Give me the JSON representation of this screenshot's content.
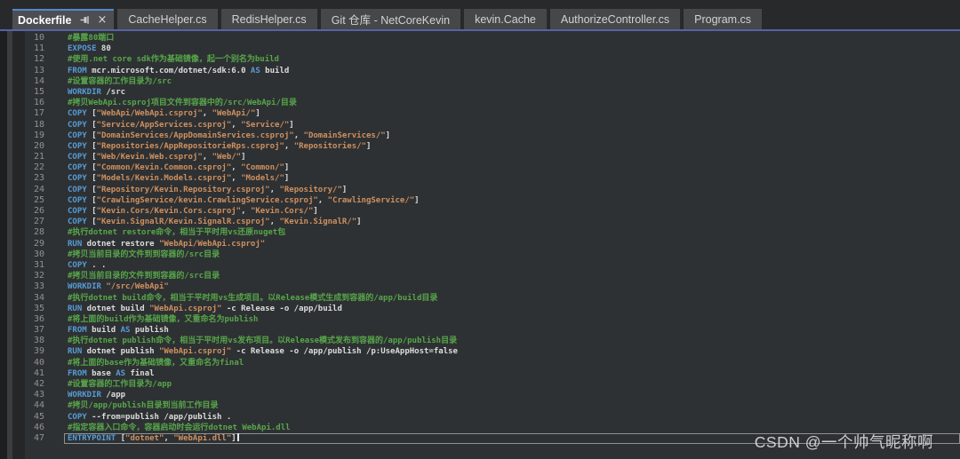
{
  "tab_bar": {
    "tabs": [
      {
        "label": "Dockerfile",
        "active": true,
        "pin": true,
        "close": "×"
      },
      {
        "label": "CacheHelper.cs",
        "active": false
      },
      {
        "label": "RedisHelper.cs",
        "active": false
      },
      {
        "label": "Git 仓库 - NetCoreKevin",
        "active": false
      },
      {
        "label": "kevin.Cache",
        "active": false
      },
      {
        "label": "AuthorizeController.cs",
        "active": false
      },
      {
        "label": "Program.cs",
        "active": false
      }
    ]
  },
  "editor": {
    "language": "dockerfile",
    "first_line_number": 10,
    "current_line": 47,
    "caret_line": 47,
    "lines": [
      {
        "n": 10,
        "segs": [
          [
            "c",
            "#暴露80端口"
          ]
        ]
      },
      {
        "n": 11,
        "segs": [
          [
            "k",
            "EXPOSE"
          ],
          [
            "p",
            " 80"
          ]
        ]
      },
      {
        "n": 12,
        "segs": [
          [
            "c",
            "#使用.net core sdk作为基础镜像，起一个别名为build"
          ]
        ]
      },
      {
        "n": 13,
        "segs": [
          [
            "k",
            "FROM"
          ],
          [
            "p",
            " mcr.microsoft.com/dotnet/sdk:6.0 "
          ],
          [
            "k",
            "AS"
          ],
          [
            "p",
            " build"
          ]
        ]
      },
      {
        "n": 14,
        "segs": [
          [
            "c",
            "#设置容器的工作目录为/src"
          ]
        ]
      },
      {
        "n": 15,
        "segs": [
          [
            "k",
            "WORKDIR"
          ],
          [
            "p",
            " /src"
          ]
        ]
      },
      {
        "n": 16,
        "segs": [
          [
            "c",
            "#拷贝WebApi.csproj项目文件到容器中的/src/WebApi/目录"
          ]
        ]
      },
      {
        "n": 17,
        "segs": [
          [
            "k",
            "COPY"
          ],
          [
            "p",
            " ["
          ],
          [
            "s",
            "\"WebApi/WebApi.csproj\""
          ],
          [
            "p",
            ", "
          ],
          [
            "s",
            "\"WebApi/\""
          ],
          [
            "p",
            "]"
          ]
        ]
      },
      {
        "n": 18,
        "segs": [
          [
            "k",
            "COPY"
          ],
          [
            "p",
            " ["
          ],
          [
            "s",
            "\"Service/AppServices.csproj\""
          ],
          [
            "p",
            ", "
          ],
          [
            "s",
            "\"Service/\""
          ],
          [
            "p",
            "]"
          ]
        ]
      },
      {
        "n": 19,
        "segs": [
          [
            "k",
            "COPY"
          ],
          [
            "p",
            " ["
          ],
          [
            "s",
            "\"DomainServices/AppDomainServices.csproj\""
          ],
          [
            "p",
            ", "
          ],
          [
            "s",
            "\"DomainServices/\""
          ],
          [
            "p",
            "]"
          ]
        ]
      },
      {
        "n": 20,
        "segs": [
          [
            "k",
            "COPY"
          ],
          [
            "p",
            " ["
          ],
          [
            "s",
            "\"Repositories/AppRepositorieRps.csproj\""
          ],
          [
            "p",
            ", "
          ],
          [
            "s",
            "\"Repositories/\""
          ],
          [
            "p",
            "]"
          ]
        ]
      },
      {
        "n": 21,
        "segs": [
          [
            "k",
            "COPY"
          ],
          [
            "p",
            " ["
          ],
          [
            "s",
            "\"Web/Kevin.Web.csproj\""
          ],
          [
            "p",
            ", "
          ],
          [
            "s",
            "\"Web/\""
          ],
          [
            "p",
            "]"
          ]
        ]
      },
      {
        "n": 22,
        "segs": [
          [
            "k",
            "COPY"
          ],
          [
            "p",
            " ["
          ],
          [
            "s",
            "\"Common/Kevin.Common.csproj\""
          ],
          [
            "p",
            ", "
          ],
          [
            "s",
            "\"Common/\""
          ],
          [
            "p",
            "]"
          ]
        ]
      },
      {
        "n": 23,
        "segs": [
          [
            "k",
            "COPY"
          ],
          [
            "p",
            " ["
          ],
          [
            "s",
            "\"Models/Kevin.Models.csproj\""
          ],
          [
            "p",
            ", "
          ],
          [
            "s",
            "\"Models/\""
          ],
          [
            "p",
            "]"
          ]
        ]
      },
      {
        "n": 24,
        "segs": [
          [
            "k",
            "COPY"
          ],
          [
            "p",
            " ["
          ],
          [
            "s",
            "\"Repository/Kevin.Repository.csproj\""
          ],
          [
            "p",
            ", "
          ],
          [
            "s",
            "\"Repository/\""
          ],
          [
            "p",
            "]"
          ]
        ]
      },
      {
        "n": 25,
        "segs": [
          [
            "k",
            "COPY"
          ],
          [
            "p",
            " ["
          ],
          [
            "s",
            "\"CrawlingService/kevin.CrawlingService.csproj\""
          ],
          [
            "p",
            ", "
          ],
          [
            "s",
            "\"CrawlingService/\""
          ],
          [
            "p",
            "]"
          ]
        ]
      },
      {
        "n": 26,
        "segs": [
          [
            "k",
            "COPY"
          ],
          [
            "p",
            " ["
          ],
          [
            "s",
            "\"Kevin.Cors/Kevin.Cors.csproj\""
          ],
          [
            "p",
            ", "
          ],
          [
            "s",
            "\"Kevin.Cors/\""
          ],
          [
            "p",
            "]"
          ]
        ]
      },
      {
        "n": 27,
        "segs": [
          [
            "k",
            "COPY"
          ],
          [
            "p",
            " ["
          ],
          [
            "s",
            "\"Kevin.SignalR/Kevin.SignalR.csproj\""
          ],
          [
            "p",
            ", "
          ],
          [
            "s",
            "\"Kevin.SignalR/\""
          ],
          [
            "p",
            "]"
          ]
        ]
      },
      {
        "n": 28,
        "segs": [
          [
            "c",
            "#执行dotnet restore命令，相当于平时用vs还原nuget包"
          ]
        ]
      },
      {
        "n": 29,
        "segs": [
          [
            "k",
            "RUN"
          ],
          [
            "p",
            " dotnet restore "
          ],
          [
            "s",
            "\"WebApi/WebApi.csproj\""
          ]
        ]
      },
      {
        "n": 30,
        "segs": [
          [
            "c",
            "#拷贝当前目录的文件到到容器的/src目录"
          ]
        ]
      },
      {
        "n": 31,
        "segs": [
          [
            "k",
            "COPY"
          ],
          [
            "p",
            " . ."
          ]
        ]
      },
      {
        "n": 32,
        "segs": [
          [
            "c",
            "#拷贝当前目录的文件到到容器的/src目录"
          ]
        ]
      },
      {
        "n": 33,
        "segs": [
          [
            "k",
            "WORKDIR"
          ],
          [
            "p",
            " "
          ],
          [
            "s",
            "\"/src/WebApi\""
          ]
        ]
      },
      {
        "n": 34,
        "segs": [
          [
            "c",
            "#执行dotnet build命令，相当于平时用vs生成项目。以Release模式生成到容器的/app/build目录"
          ]
        ]
      },
      {
        "n": 35,
        "segs": [
          [
            "k",
            "RUN"
          ],
          [
            "p",
            " dotnet build "
          ],
          [
            "s",
            "\"WebApi.csproj\""
          ],
          [
            "p",
            " -c Release -o /app/build"
          ]
        ]
      },
      {
        "n": 36,
        "segs": [
          [
            "c",
            "#将上面的build作为基础镜像，又重命名为publish"
          ]
        ]
      },
      {
        "n": 37,
        "segs": [
          [
            "k",
            "FROM"
          ],
          [
            "p",
            " build "
          ],
          [
            "k",
            "AS"
          ],
          [
            "p",
            " publish"
          ]
        ]
      },
      {
        "n": 38,
        "segs": [
          [
            "c",
            "#执行dotnet publish命令，相当于平时用vs发布项目。以Release模式发布到容器的/app/publish目录"
          ]
        ]
      },
      {
        "n": 39,
        "segs": [
          [
            "k",
            "RUN"
          ],
          [
            "p",
            " dotnet publish "
          ],
          [
            "s",
            "\"WebApi.csproj\""
          ],
          [
            "p",
            " -c Release -o /app/publish /p:UseAppHost=false"
          ]
        ]
      },
      {
        "n": 40,
        "segs": [
          [
            "c",
            "#将上面的base作为基础镜像，又重命名为final"
          ]
        ]
      },
      {
        "n": 41,
        "segs": [
          [
            "k",
            "FROM"
          ],
          [
            "p",
            " base "
          ],
          [
            "k",
            "AS"
          ],
          [
            "p",
            " final"
          ]
        ]
      },
      {
        "n": 42,
        "segs": [
          [
            "c",
            "#设置容器的工作目录为/app"
          ]
        ]
      },
      {
        "n": 43,
        "segs": [
          [
            "k",
            "WORKDIR"
          ],
          [
            "p",
            " /app"
          ]
        ]
      },
      {
        "n": 44,
        "segs": [
          [
            "c",
            "#拷贝/app/publish目录到当前工作目录"
          ]
        ]
      },
      {
        "n": 45,
        "segs": [
          [
            "k",
            "COPY"
          ],
          [
            "p",
            " --from=publish /app/publish ."
          ]
        ]
      },
      {
        "n": 46,
        "segs": [
          [
            "c",
            "#指定容器入口命令，容器启动时会运行dotnet WebApi.dll"
          ]
        ]
      },
      {
        "n": 47,
        "segs": [
          [
            "k",
            "ENTRYPOINT"
          ],
          [
            "p",
            " ["
          ],
          [
            "s",
            "\"dotnet\""
          ],
          [
            "p",
            ", "
          ],
          [
            "s",
            "\"WebApi.dll\""
          ],
          [
            "p",
            "]"
          ]
        ]
      }
    ]
  },
  "watermark": {
    "text": "CSDN @一个帅气昵称啊"
  },
  "colors": {
    "keyword": "#569cd6",
    "string": "#ce9060",
    "comment": "#57a64a",
    "plain": "#dcdcdc",
    "editor_bg": "#2e3133",
    "line_number": "#909294",
    "tab_active_border": "#4e8ad0",
    "tabstrip_underline": "#5465a5"
  }
}
